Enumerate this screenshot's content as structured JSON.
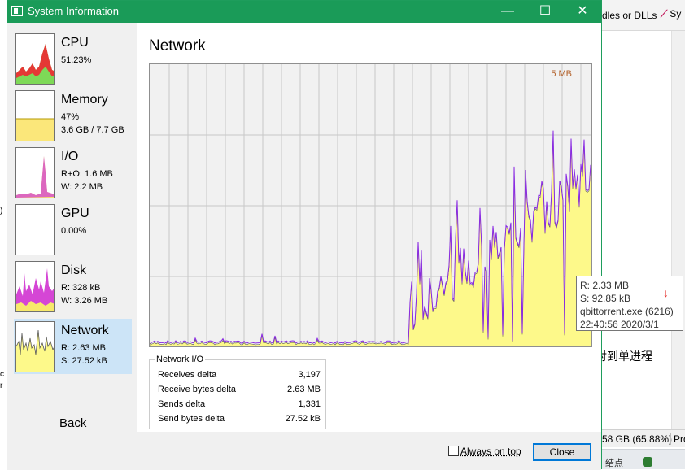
{
  "background_app": {
    "tab1": "dles or DLLs",
    "tab2": "Sy",
    "status_left": "58 GB (65.88%)",
    "status_right": "Pro",
    "taskbar_text": "结点",
    "left_edge_1": ")",
    "left_edge_2": "c\nr"
  },
  "window": {
    "title": "System Information",
    "icons": {
      "app": "window-icon",
      "min": "minimize-icon",
      "max": "maximize-icon",
      "close": "close-icon"
    },
    "accent_color": "#1a9b58"
  },
  "sidebar": {
    "items": [
      {
        "name": "CPU",
        "line1": "51.23%",
        "line2": "",
        "selected": false
      },
      {
        "name": "Memory",
        "line1": "47%",
        "line2": "3.6 GB / 7.7 GB",
        "selected": false
      },
      {
        "name": "I/O",
        "line1": "R+O: 1.6 MB",
        "line2": "W: 2.2 MB",
        "selected": false
      },
      {
        "name": "GPU",
        "line1": "0.00%",
        "line2": "",
        "selected": false
      },
      {
        "name": "Disk",
        "line1": "R: 328 kB",
        "line2": "W: 3.26 MB",
        "selected": false
      },
      {
        "name": "Network",
        "line1": "R: 2.63 MB",
        "line2": "S: 27.52 kB",
        "selected": true
      }
    ],
    "back_label": "Back"
  },
  "panel": {
    "title": "Network",
    "graph_max_label": "5 MB",
    "tooltip": {
      "line1": "R: 2.33 MB",
      "line2": "S: 92.85 kB",
      "line3": "qbittorrent.exe (6216)",
      "line4": "22:40:56 2020/3/1"
    },
    "stats_title": "Network I/O",
    "stats": [
      {
        "label": "Receives delta",
        "value": "3,197"
      },
      {
        "label": "Receive bytes delta",
        "value": "2.63 MB"
      },
      {
        "label": "Sends delta",
        "value": "1,331"
      },
      {
        "label": "Send bytes delta",
        "value": "27.52 kB"
      }
    ]
  },
  "footer": {
    "always_on_top_label": "Always on top",
    "always_on_top_checked": false,
    "close_label": "Close"
  },
  "annotation": "针对到单进程",
  "colors": {
    "receive": "#fdf98a",
    "send": "#8a2be2",
    "selected_bg": "#cce4f7"
  }
}
